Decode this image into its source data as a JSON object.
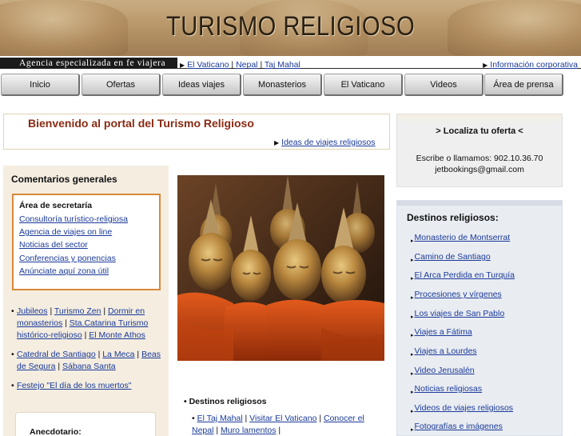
{
  "header": {
    "title": "TURISMO RELIGIOSO",
    "tagline": "Agencia especializada en fe viajera",
    "quick_links": [
      "El Vaticano",
      "Nepal",
      "Taj Mahal"
    ],
    "corporate_link": "Información corporativa"
  },
  "nav": {
    "tabs": [
      "Inicio",
      "Ofertas",
      "Ideas viajes",
      "Monasterios",
      "El Vaticano",
      "Videos",
      "Área de prensa"
    ]
  },
  "welcome": {
    "heading": "Bienvenido al portal del Turismo Religioso",
    "link": "Ideas de viajes religiosos"
  },
  "offer": {
    "heading": "> Localiza tu oferta <",
    "contact_line": "Escribe o llamamos: 902.10.36.70",
    "email": "jetbookings@gmail.com"
  },
  "left": {
    "heading": "Comentarios generales",
    "secretaria": {
      "title": "Área de secretaría",
      "links": [
        "Consultoría turístico-religiosa",
        "Agencia de viajes on line",
        "Noticias del sector",
        "Conferencias y ponencias",
        "Anúnciate aquí zona útil"
      ]
    },
    "bullet_groups": [
      [
        "Jubileos",
        "Turismo Zen",
        "Dormir en monasterios",
        "Sta.Catarina Turismo histórico-religioso",
        "El Monte Athos"
      ],
      [
        "Catedral de Santiago",
        "La Meca",
        "Beas de Segura",
        "Sábana Santa"
      ],
      [
        "Festejo \"El día de los muertos\""
      ]
    ],
    "anecdotario": "Anecdotario:"
  },
  "center": {
    "heading": "Destinos religiosos",
    "links": [
      "El Taj Mahal",
      "Visitar El Vaticano",
      "Conocer el Nepal",
      "Muro lamentos"
    ]
  },
  "right": {
    "heading": "Destinos religiosos:",
    "items": [
      "Monasterio de Montserrat",
      "Camino de Santiago",
      "El Arca Perdida en Turquía",
      "Procesiones y vírgenes",
      "Los viajes de San Pablo",
      "Viajes a Fátima",
      "Viajes a Lourdes",
      "Video Jerusalén",
      "Noticias religiosas",
      "Videos de viajes religiosos",
      "Fotografías e imágenes"
    ]
  },
  "colors": {
    "heading_red": "#8a2a12",
    "link_blue": "#1a3a9a",
    "box_orange": "#d8893a",
    "left_bg": "#f4ede0",
    "right_bg": "#e9ecf1"
  }
}
